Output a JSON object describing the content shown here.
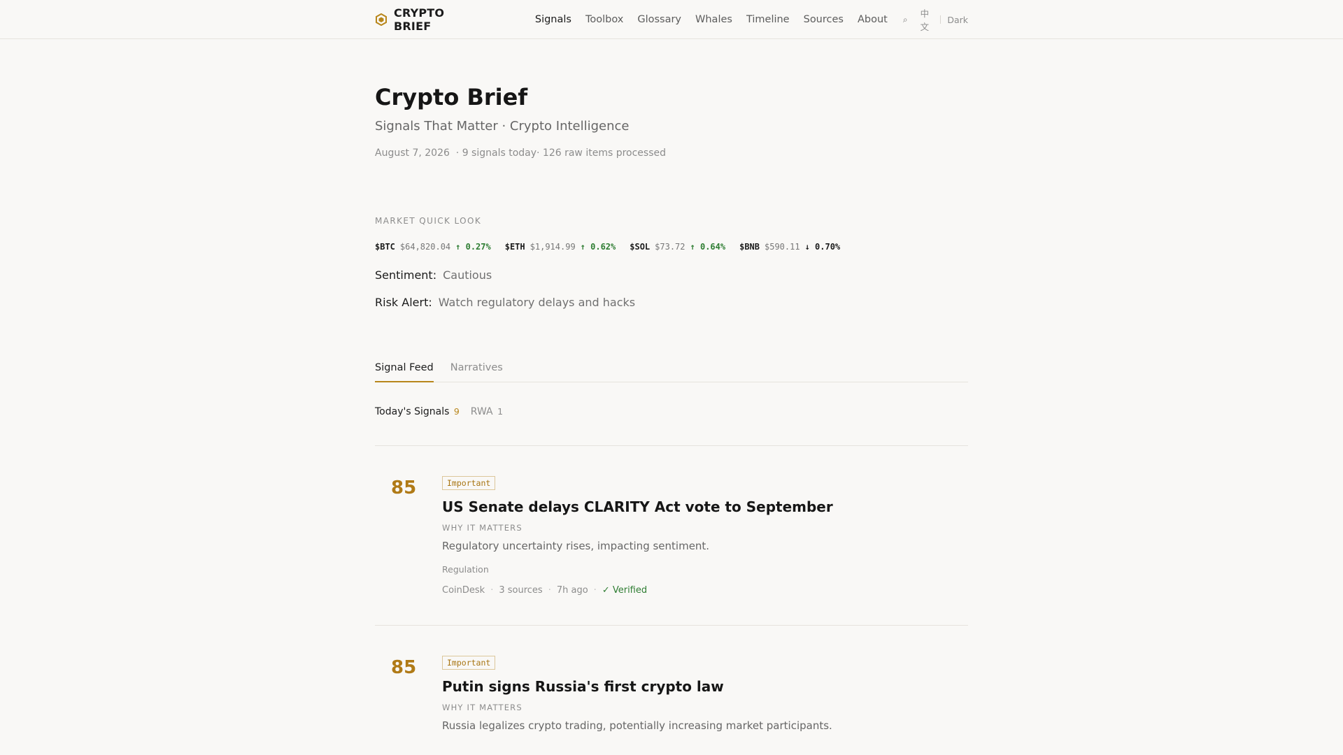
{
  "brand": {
    "name": "CRYPTO BRIEF",
    "icon": "hexagon-logo-icon",
    "accent": "#b8861b"
  },
  "nav": {
    "links": [
      "Signals",
      "Toolbox",
      "Glossary",
      "Whales",
      "Timeline",
      "Sources",
      "About"
    ],
    "search_icon": "⌕",
    "lang": "中文",
    "theme": "Dark"
  },
  "hero": {
    "title": "Crypto Brief",
    "subtitle": "Signals That Matter · Crypto Intelligence",
    "date": "August 7, 2026",
    "stats": "· 9 signals today· 126 raw items processed"
  },
  "market": {
    "label": "MARKET QUICK LOOK",
    "tickers": [
      {
        "symbol": "$BTC",
        "price": "$64,820.04",
        "change": "↑ 0.27%",
        "direction": "up"
      },
      {
        "symbol": "$ETH",
        "price": "$1,914.99",
        "change": "↑ 0.62%",
        "direction": "up"
      },
      {
        "symbol": "$SOL",
        "price": "$73.72",
        "change": "↑ 0.64%",
        "direction": "up"
      },
      {
        "symbol": "$BNB",
        "price": "$590.11",
        "change": "↓ 0.70%",
        "direction": "down"
      }
    ],
    "sentiment_label": "Sentiment:",
    "sentiment_value": "Cautious",
    "risk_label": "Risk Alert:",
    "risk_value": "Watch regulatory delays and hacks"
  },
  "tabs": [
    "Signal Feed",
    "Narratives"
  ],
  "filters": [
    {
      "label": "Today's Signals",
      "count": "9"
    },
    {
      "label": "RWA",
      "count": "1"
    }
  ],
  "signals": [
    {
      "score": "85",
      "badge": "Important",
      "title": "US Senate delays CLARITY Act vote to September",
      "why_label": "WHY IT MATTERS",
      "why": "Regulatory uncertainty rises, impacting sentiment.",
      "tag": "Regulation",
      "source": "CoinDesk",
      "sources_count": "3 sources",
      "time": "7h ago",
      "verified": "✓ Verified"
    },
    {
      "score": "85",
      "badge": "Important",
      "title": "Putin signs Russia's first crypto law",
      "why_label": "WHY IT MATTERS",
      "why": "Russia legalizes crypto trading, potentially increasing market participants."
    }
  ]
}
